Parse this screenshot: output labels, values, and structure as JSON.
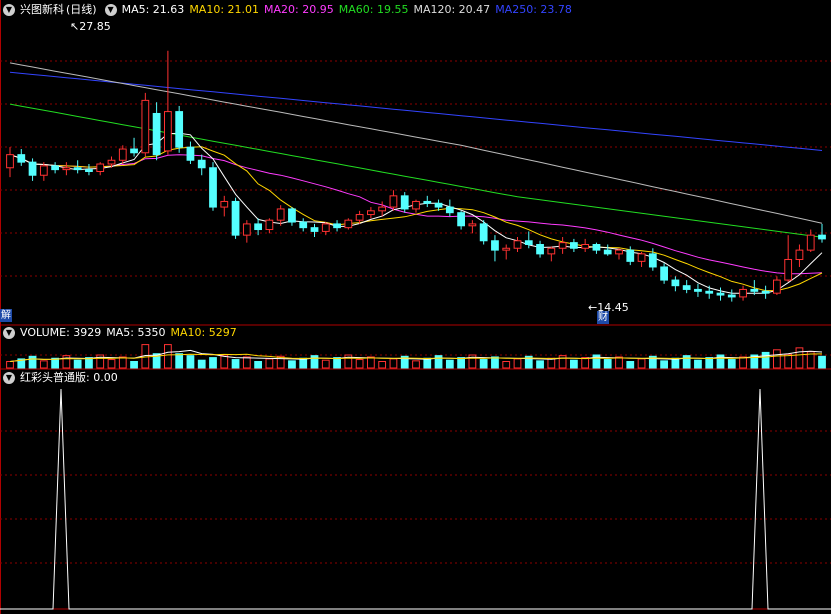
{
  "main": {
    "title": "兴图新科",
    "period": "(日线)",
    "ma": [
      {
        "label": "MA5: 21.63",
        "color": "#ffffff"
      },
      {
        "label": "MA10: 21.01",
        "color": "#ffd700"
      },
      {
        "label": "MA20: 20.95",
        "color": "#ff3cff"
      },
      {
        "label": "MA60: 19.55",
        "color": "#22dd22"
      },
      {
        "label": "MA120: 20.47",
        "color": "#dddddd"
      },
      {
        "label": "MA250: 23.78",
        "color": "#3344ff"
      }
    ],
    "high_label": "27.85",
    "low_label": "14.45",
    "left_tag": "解",
    "low_tag": "财"
  },
  "volume": {
    "title": "VOLUME: 3929",
    "ma5": "MA5: 5350",
    "ma10": "MA10: 5297"
  },
  "indicator": {
    "title": "红彩头普通版",
    "value": ": 0.00"
  },
  "colors": {
    "up": "#ff3232",
    "down": "#54ffff",
    "grid": "#8b0000",
    "border": "#b00000",
    "volume_ma5": "#ffffff",
    "volume_ma10": "#ffd700",
    "indicator": "#ffffff"
  },
  "chart_data": {
    "type": "candlestick",
    "ylim": [
      13.2,
      29.6
    ],
    "candles": [
      {
        "o": 21.6,
        "h": 22.7,
        "l": 21.1,
        "c": 22.3
      },
      {
        "o": 22.3,
        "h": 22.6,
        "l": 21.7,
        "c": 21.9
      },
      {
        "o": 21.9,
        "h": 22.1,
        "l": 20.9,
        "c": 21.2
      },
      {
        "o": 21.2,
        "h": 21.9,
        "l": 20.9,
        "c": 21.7
      },
      {
        "o": 21.7,
        "h": 21.9,
        "l": 21.3,
        "c": 21.5
      },
      {
        "o": 21.5,
        "h": 21.9,
        "l": 21.2,
        "c": 21.6
      },
      {
        "o": 21.6,
        "h": 22.0,
        "l": 21.3,
        "c": 21.5
      },
      {
        "o": 21.5,
        "h": 21.8,
        "l": 21.2,
        "c": 21.4
      },
      {
        "o": 21.4,
        "h": 21.9,
        "l": 21.2,
        "c": 21.8
      },
      {
        "o": 21.8,
        "h": 22.2,
        "l": 21.6,
        "c": 22.0
      },
      {
        "o": 22.0,
        "h": 22.8,
        "l": 21.8,
        "c": 22.6
      },
      {
        "o": 22.6,
        "h": 23.2,
        "l": 22.2,
        "c": 22.4
      },
      {
        "o": 22.4,
        "h": 25.6,
        "l": 22.2,
        "c": 25.2
      },
      {
        "o": 24.5,
        "h": 25.1,
        "l": 22.0,
        "c": 22.3
      },
      {
        "o": 22.5,
        "h": 27.85,
        "l": 22.3,
        "c": 24.6
      },
      {
        "o": 24.6,
        "h": 24.9,
        "l": 22.4,
        "c": 22.7
      },
      {
        "o": 22.7,
        "h": 23.0,
        "l": 21.8,
        "c": 22.0
      },
      {
        "o": 22.0,
        "h": 22.3,
        "l": 21.2,
        "c": 21.6
      },
      {
        "o": 21.6,
        "h": 21.9,
        "l": 19.3,
        "c": 19.5
      },
      {
        "o": 19.5,
        "h": 20.1,
        "l": 19.0,
        "c": 19.8
      },
      {
        "o": 19.8,
        "h": 20.0,
        "l": 17.8,
        "c": 18.0
      },
      {
        "o": 18.0,
        "h": 18.8,
        "l": 17.6,
        "c": 18.6
      },
      {
        "o": 18.6,
        "h": 18.9,
        "l": 18.0,
        "c": 18.3
      },
      {
        "o": 18.3,
        "h": 18.9,
        "l": 18.1,
        "c": 18.8
      },
      {
        "o": 18.8,
        "h": 19.6,
        "l": 18.5,
        "c": 19.4
      },
      {
        "o": 19.4,
        "h": 19.5,
        "l": 18.5,
        "c": 18.7
      },
      {
        "o": 18.7,
        "h": 18.9,
        "l": 18.2,
        "c": 18.4
      },
      {
        "o": 18.4,
        "h": 18.6,
        "l": 17.9,
        "c": 18.2
      },
      {
        "o": 18.2,
        "h": 18.7,
        "l": 18.0,
        "c": 18.6
      },
      {
        "o": 18.6,
        "h": 18.8,
        "l": 18.2,
        "c": 18.4
      },
      {
        "o": 18.4,
        "h": 18.9,
        "l": 18.3,
        "c": 18.8
      },
      {
        "o": 18.8,
        "h": 19.3,
        "l": 18.6,
        "c": 19.1
      },
      {
        "o": 19.1,
        "h": 19.5,
        "l": 18.9,
        "c": 19.3
      },
      {
        "o": 19.3,
        "h": 19.8,
        "l": 19.0,
        "c": 19.5
      },
      {
        "o": 19.5,
        "h": 20.4,
        "l": 19.3,
        "c": 20.1
      },
      {
        "o": 20.1,
        "h": 20.3,
        "l": 19.2,
        "c": 19.4
      },
      {
        "o": 19.4,
        "h": 19.9,
        "l": 19.2,
        "c": 19.8
      },
      {
        "o": 19.8,
        "h": 20.1,
        "l": 19.5,
        "c": 19.7
      },
      {
        "o": 19.7,
        "h": 19.9,
        "l": 19.3,
        "c": 19.5
      },
      {
        "o": 19.5,
        "h": 19.9,
        "l": 19.0,
        "c": 19.2
      },
      {
        "o": 19.2,
        "h": 19.3,
        "l": 18.3,
        "c": 18.5
      },
      {
        "o": 18.5,
        "h": 18.8,
        "l": 18.1,
        "c": 18.6
      },
      {
        "o": 18.6,
        "h": 18.8,
        "l": 17.5,
        "c": 17.7
      },
      {
        "o": 17.7,
        "h": 18.0,
        "l": 16.6,
        "c": 17.2
      },
      {
        "o": 17.2,
        "h": 17.5,
        "l": 16.7,
        "c": 17.3
      },
      {
        "o": 17.3,
        "h": 17.9,
        "l": 17.1,
        "c": 17.7
      },
      {
        "o": 17.7,
        "h": 18.2,
        "l": 17.3,
        "c": 17.5
      },
      {
        "o": 17.5,
        "h": 17.7,
        "l": 16.8,
        "c": 17.0
      },
      {
        "o": 17.0,
        "h": 17.4,
        "l": 16.6,
        "c": 17.3
      },
      {
        "o": 17.3,
        "h": 17.9,
        "l": 17.0,
        "c": 17.6
      },
      {
        "o": 17.6,
        "h": 17.8,
        "l": 17.1,
        "c": 17.3
      },
      {
        "o": 17.3,
        "h": 17.8,
        "l": 17.1,
        "c": 17.5
      },
      {
        "o": 17.5,
        "h": 17.6,
        "l": 17.0,
        "c": 17.2
      },
      {
        "o": 17.2,
        "h": 17.5,
        "l": 16.9,
        "c": 17.0
      },
      {
        "o": 17.0,
        "h": 17.3,
        "l": 16.7,
        "c": 17.2
      },
      {
        "o": 17.2,
        "h": 17.4,
        "l": 16.4,
        "c": 16.6
      },
      {
        "o": 16.6,
        "h": 17.1,
        "l": 16.3,
        "c": 17.0
      },
      {
        "o": 17.0,
        "h": 17.3,
        "l": 16.1,
        "c": 16.3
      },
      {
        "o": 16.3,
        "h": 16.5,
        "l": 15.4,
        "c": 15.6
      },
      {
        "o": 15.6,
        "h": 15.8,
        "l": 15.0,
        "c": 15.3
      },
      {
        "o": 15.3,
        "h": 15.6,
        "l": 14.9,
        "c": 15.1
      },
      {
        "o": 15.1,
        "h": 15.4,
        "l": 14.7,
        "c": 15.0
      },
      {
        "o": 15.0,
        "h": 15.3,
        "l": 14.6,
        "c": 14.9
      },
      {
        "o": 14.9,
        "h": 15.2,
        "l": 14.5,
        "c": 14.8
      },
      {
        "o": 14.8,
        "h": 15.1,
        "l": 14.45,
        "c": 14.7
      },
      {
        "o": 14.7,
        "h": 15.3,
        "l": 14.5,
        "c": 15.1
      },
      {
        "o": 15.1,
        "h": 15.6,
        "l": 14.8,
        "c": 15.0
      },
      {
        "o": 15.0,
        "h": 15.3,
        "l": 14.6,
        "c": 14.9
      },
      {
        "o": 14.9,
        "h": 15.8,
        "l": 14.8,
        "c": 15.6
      },
      {
        "o": 15.6,
        "h": 18.0,
        "l": 15.5,
        "c": 16.7
      },
      {
        "o": 16.7,
        "h": 17.5,
        "l": 16.3,
        "c": 17.2
      },
      {
        "o": 17.2,
        "h": 18.3,
        "l": 17.1,
        "c": 18.0
      },
      {
        "o": 18.0,
        "h": 18.6,
        "l": 17.6,
        "c": 17.8
      }
    ]
  }
}
